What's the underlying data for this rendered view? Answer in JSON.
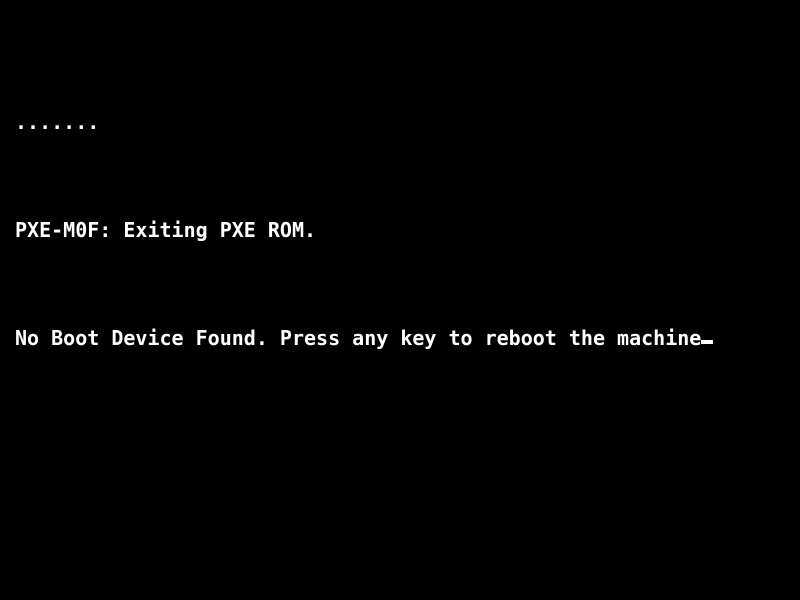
{
  "screen": {
    "background_color": "#000000",
    "text_color": "#ffffff",
    "mode": "text-console",
    "lines": [
      {
        "id": "progress-dots",
        "text": "......."
      },
      {
        "id": "pxe-status",
        "text": "PXE-M0F: Exiting PXE ROM."
      },
      {
        "id": "boot-error",
        "text": "No Boot Device Found. Press any key to reboot the machine"
      }
    ],
    "cursor": {
      "shape": "underscore-block",
      "visible": true,
      "color": "#ffffff"
    }
  }
}
